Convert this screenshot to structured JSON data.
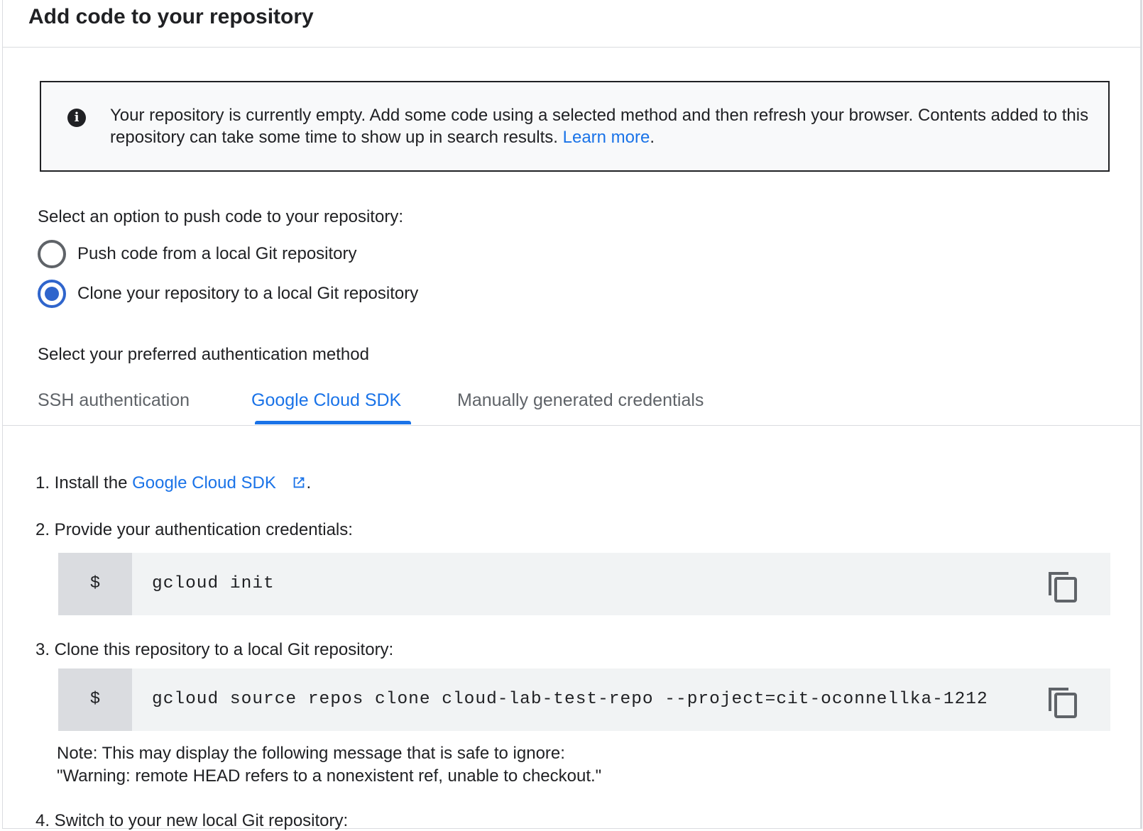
{
  "header": {
    "title": "Add code to your repository"
  },
  "info": {
    "icon": "info-icon",
    "text": "Your repository is currently empty. Add some code using a selected method and then refresh your browser. Contents added to this repository can take some time to show up in search results. ",
    "link": "Learn more",
    "suffix": "."
  },
  "push_options": {
    "label": "Select an option to push code to your repository:",
    "options": [
      {
        "label": "Push code from a local Git repository",
        "selected": false
      },
      {
        "label": "Clone your repository to a local Git repository",
        "selected": true
      }
    ]
  },
  "auth": {
    "label": "Select your preferred authentication method",
    "tabs": [
      {
        "label": "SSH authentication",
        "active": false
      },
      {
        "label": "Google Cloud SDK",
        "active": true
      },
      {
        "label": "Manually generated credentials",
        "active": false
      }
    ]
  },
  "steps": [
    {
      "prefix": "1. Install the ",
      "link": "Google Cloud SDK",
      "suffix": "."
    },
    {
      "text": "2. Provide your authentication credentials:",
      "prompt": "$",
      "command": "gcloud init"
    },
    {
      "text": "3. Clone this repository to a local Git repository:",
      "prompt": "$",
      "command": "gcloud source repos clone cloud-lab-test-repo --project=cit-oconnellka-1212",
      "note1": "Note: This may display the following message that is safe to ignore:",
      "note2": "\"Warning: remote HEAD refers to a nonexistent ref, unable to checkout.\""
    },
    {
      "text": "4. Switch to your new local Git repository:"
    }
  ],
  "colors": {
    "accent": "#1a73e8",
    "radio": "#2f65cc",
    "code_bg": "#f1f3f4",
    "prompt_bg": "#dadce0"
  }
}
